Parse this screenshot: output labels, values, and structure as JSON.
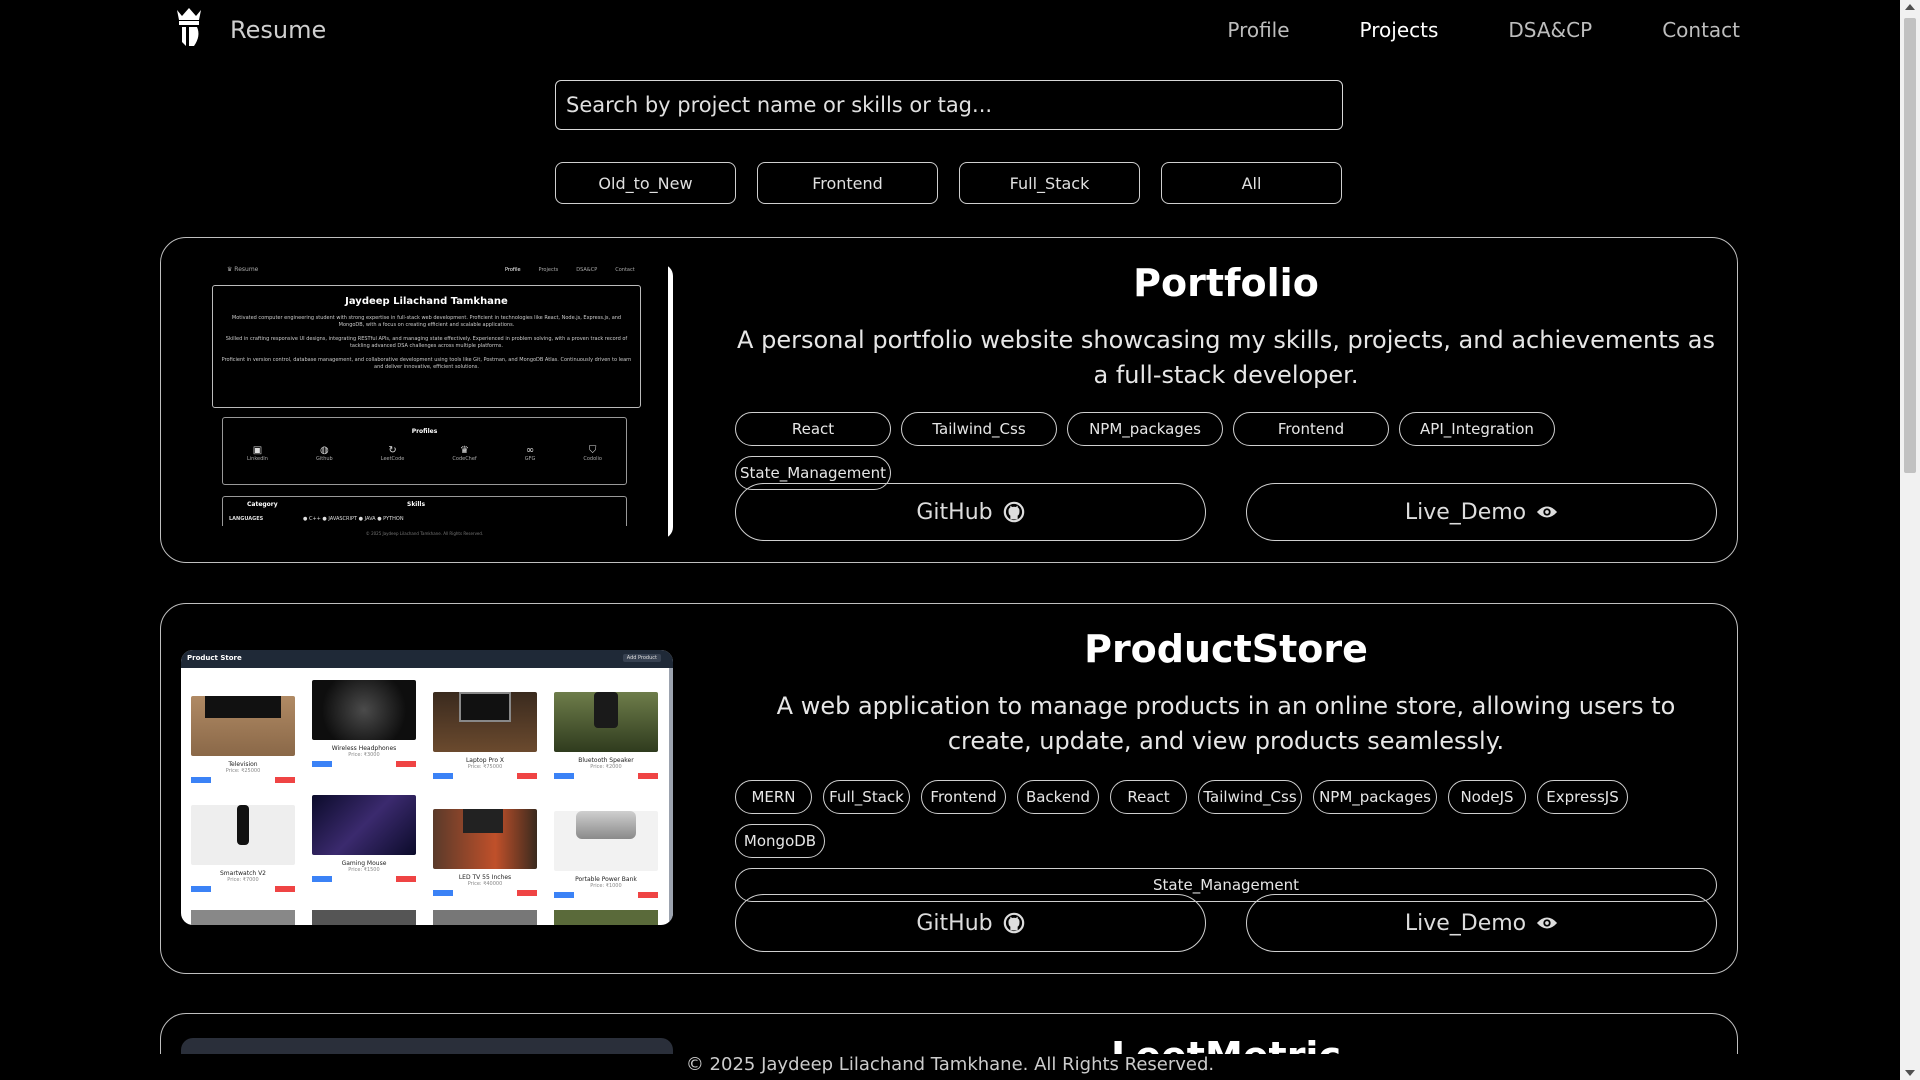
{
  "nav": {
    "brand": "Resume",
    "links": [
      "Profile",
      "Projects",
      "DSA&CP",
      "Contact"
    ],
    "active": "Projects"
  },
  "search": {
    "placeholder": "Search by project name or skills or tag..."
  },
  "filters": [
    "Old_to_New",
    "Frontend",
    "Full_Stack",
    "All"
  ],
  "projects": [
    {
      "title": "Portfolio",
      "description": "A personal portfolio website showcasing my skills, projects, and achievements as a full-stack developer.",
      "tags": [
        "React",
        "Tailwind_Css",
        "NPM_packages",
        "Frontend",
        "API_Integration",
        "State_Management"
      ],
      "github_label": "GitHub",
      "demo_label": "Live_Demo",
      "preview": {
        "brand": "Resume",
        "nav": [
          "Profile",
          "Projects",
          "DSA&CP",
          "Contact"
        ],
        "name": "Jaydeep Lilachand Tamkhane",
        "para1": "Motivated computer engineering student with strong expertise in full-stack web development. Proficient in technologies like React, Node.js, Express.js, and MongoDB, with a focus on creating efficient and scalable applications.",
        "para2": "Skilled in crafting responsive UI designs, integrating RESTful APIs, and managing state effectively. Experienced in problem solving, with a proven track record of tackling advanced DSA challenges across multiple platforms.",
        "para3": "Proficient in version control, database management, and collaborative development using tools like Git, Postman, and MongoDB Atlas. Continuously driven to learn and deliver innovative, efficient solutions.",
        "profiles_title": "Profiles",
        "profiles": [
          "LinkedIn",
          "Github",
          "LeetCode",
          "CodeChef",
          "GFG",
          "Codolio"
        ],
        "table_headers": [
          "Category",
          "Skills"
        ],
        "table_row_label": "LANGUAGES",
        "table_row_skills": "● C++   ● JAVASCRIPT   ● JAVA   ● PYTHON",
        "footer": "© 2025 Jaydeep Lilachand Tamkhane. All Rights Reserved."
      }
    },
    {
      "title": "ProductStore",
      "description": "A web application to manage products in an online store, allowing users to create, update, and view products seamlessly.",
      "tags": [
        "MERN",
        "Full_Stack",
        "Frontend",
        "Backend",
        "React",
        "Tailwind_Css",
        "NPM_packages",
        "NodeJS",
        "ExpressJS",
        "MongoDB",
        "State_Management"
      ],
      "github_label": "GitHub",
      "demo_label": "Live_Demo",
      "preview": {
        "title": "Product Store",
        "add_button": "Add Product",
        "products": [
          {
            "name": "Television",
            "price": "Price: ₹25000"
          },
          {
            "name": "Wireless Headphones",
            "price": "Price: ₹3000"
          },
          {
            "name": "Laptop Pro X",
            "price": "Price: ₹75000"
          },
          {
            "name": "Bluetooth Speaker",
            "price": "Price: ₹2000"
          },
          {
            "name": "Smartwatch V2",
            "price": "Price: ₹7000"
          },
          {
            "name": "Gaming Mouse",
            "price": "Price: ₹1500"
          },
          {
            "name": "LED TV 55 Inches",
            "price": "Price: ₹40000"
          },
          {
            "name": "Portable Power Bank",
            "price": "Price: ₹1000"
          }
        ],
        "update_label": "Update",
        "delete_label": "Delete"
      }
    },
    {
      "title_partial": "LeetMetric"
    }
  ],
  "footer": "© 2025 Jaydeep Lilachand Tamkhane. All Rights Reserved.",
  "colors": {
    "background": "#000000",
    "border": "#cfcfcf",
    "text": "#e6e6e6",
    "update_blue": "#3b82f6",
    "delete_red": "#ef4444"
  }
}
